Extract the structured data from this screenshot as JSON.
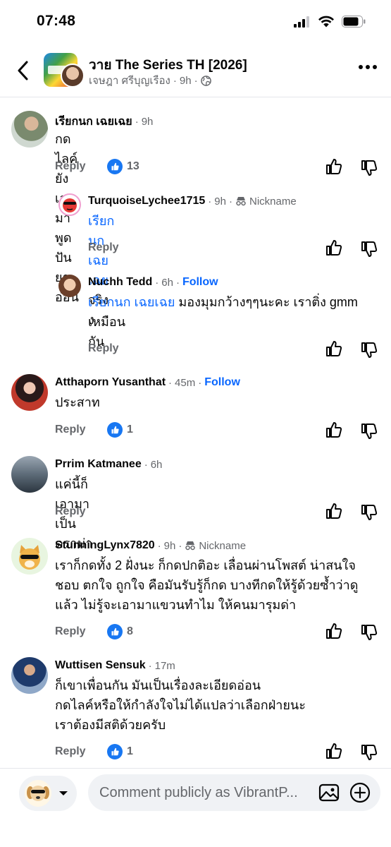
{
  "status": {
    "time": "07:48"
  },
  "header": {
    "title": "วาย The Series TH [2026]",
    "author": "เจษฎา ศรีบุญเรือง",
    "time": "9h",
    "dot": "·"
  },
  "comments": [
    {
      "name": "เรียกนก เฉยเฉย",
      "time": "9h",
      "text": "กดไลค์ยังเอามาพูด ปันยาอ่อน",
      "reply": "Reply",
      "likes": "13"
    },
    {
      "name": "TurquoiseLychee1715",
      "time": "9h",
      "badge": "Nickname",
      "mention": "เรียกนก เฉยเฉย",
      "text": " จริงง",
      "reply": "Reply"
    },
    {
      "name": "Nuchh Tedd",
      "time": "6h",
      "follow": "Follow",
      "mention": "เรียกนก เฉยเฉย",
      "text_line1": " มองมุมกว้างๆๆนะคะ เราติ่ง gmm",
      "text_line2": "เหมือนกัน",
      "reply": "Reply"
    },
    {
      "name": "Atthaporn Yusanthat",
      "time": "45m",
      "follow": "Follow",
      "text": "ประสาท",
      "reply": "Reply",
      "likes": "1"
    },
    {
      "name": "Prrim Katmanee",
      "time": "6h",
      "text": "แค่นี้ก็เอามาเป็นดราม่า",
      "reply": "Reply"
    },
    {
      "name": "StunningLynx7820",
      "time": "9h",
      "badge": "Nickname",
      "lines": [
        "เราก็กดทั้ง 2 ฝั่งนะ ก็กดปกติอะ เลื่อนผ่านโพสต์ น่าสนใจ",
        "ชอบ ตกใจ ถูกใจ คือมันรับรู้ก็กด บางทีกดให้รู้ด้วยซ้ำว่าดู",
        "แล้ว ไม่รู้จะเอามาแขวนทำไม ให้คนมารุมด่า"
      ],
      "reply": "Reply",
      "likes": "8"
    },
    {
      "name": "Wuttisen Sensuk",
      "time": "17m",
      "lines": [
        "ก็เขาเพื่อนกัน มันเป็นเรื่องละเอียดอ่อน",
        "กดไลค์หรือให้กำลังใจไม่ได้แปลว่าเลือกฝ่ายนะ",
        "เราต้องมีสติด้วยครับ"
      ],
      "reply": "Reply",
      "likes": "1"
    }
  ],
  "composer": {
    "placeholder": "Comment publicly as VibrantP..."
  },
  "colors": {
    "link": "#0866ff",
    "like": "#1877f2",
    "secondary": "#65676b"
  },
  "icons": [
    "back-icon",
    "more-icon",
    "globe-icon",
    "thumbs-up-icon",
    "thumbs-down-icon",
    "incognito-icon",
    "photo-icon",
    "plus-circle-icon",
    "chevron-down-icon"
  ]
}
